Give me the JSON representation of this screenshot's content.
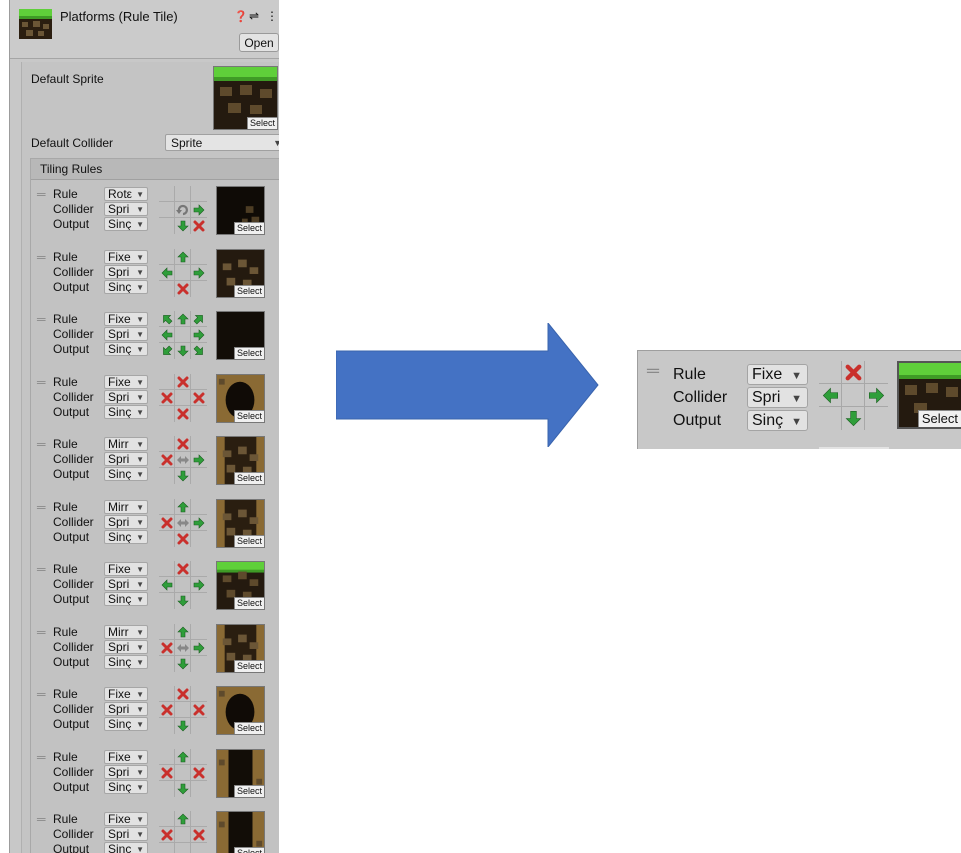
{
  "inspector": {
    "title": "Platforms (Rule Tile)",
    "help_icon": "help-icon",
    "preset_icon": "preset-icon",
    "more_icon": "more-icon",
    "open_label": "Open",
    "default_sprite_label": "Default Sprite",
    "select_label": "Select",
    "default_collider_label": "Default Collider",
    "default_collider_value": "Sprite",
    "tiling_rules_label": "Tiling Rules"
  },
  "labels": {
    "rule": "Rule",
    "collider": "Collider",
    "output": "Output"
  },
  "rules": [
    {
      "rule": "Rotε",
      "collider": "Spri",
      "output": "Sinç",
      "grid": [
        "",
        "",
        "",
        "",
        "rot",
        "right",
        "",
        "down",
        "x"
      ],
      "sprite": "dirt-corner"
    },
    {
      "rule": "Fixe",
      "collider": "Spri",
      "output": "Sinç",
      "grid": [
        "",
        "up",
        "",
        "left",
        "",
        "right",
        "",
        "x",
        ""
      ],
      "sprite": "dirt-full"
    },
    {
      "rule": "Fixe",
      "collider": "Spri",
      "output": "Sinç",
      "grid": [
        "upleft",
        "up",
        "upright",
        "left",
        "",
        "right",
        "downleft",
        "down",
        "downright"
      ],
      "sprite": "dark"
    },
    {
      "rule": "Fixe",
      "collider": "Spri",
      "output": "Sinç",
      "grid": [
        "",
        "x",
        "",
        "x",
        "",
        "x",
        "",
        "x",
        ""
      ],
      "sprite": "hole"
    },
    {
      "rule": "Mirr",
      "collider": "Spri",
      "output": "Sinç",
      "grid": [
        "",
        "x",
        "",
        "x",
        "mirror",
        "right",
        "",
        "down",
        ""
      ],
      "sprite": "dirt-edge"
    },
    {
      "rule": "Mirr",
      "collider": "Spri",
      "output": "Sinç",
      "grid": [
        "",
        "up",
        "",
        "x",
        "mirror",
        "right",
        "",
        "x",
        ""
      ],
      "sprite": "dirt-edge"
    },
    {
      "rule": "Fixe",
      "collider": "Spri",
      "output": "Sinç",
      "grid": [
        "",
        "x",
        "",
        "left",
        "",
        "right",
        "",
        "down",
        ""
      ],
      "sprite": "grass"
    },
    {
      "rule": "Mirr",
      "collider": "Spri",
      "output": "Sinç",
      "grid": [
        "",
        "up",
        "",
        "x",
        "mirror",
        "right",
        "",
        "down",
        ""
      ],
      "sprite": "dirt-edge"
    },
    {
      "rule": "Fixe",
      "collider": "Spri",
      "output": "Sinç",
      "grid": [
        "",
        "x",
        "",
        "x",
        "",
        "x",
        "",
        "down",
        ""
      ],
      "sprite": "hole"
    },
    {
      "rule": "Fixe",
      "collider": "Spri",
      "output": "Sinç",
      "grid": [
        "",
        "up",
        "",
        "x",
        "",
        "x",
        "",
        "down",
        ""
      ],
      "sprite": "column"
    },
    {
      "rule": "Fixe",
      "collider": "Spri",
      "output": "Sinç",
      "grid": [
        "",
        "up",
        "",
        "x",
        "",
        "x",
        "",
        "",
        ""
      ],
      "sprite": "column"
    }
  ],
  "zoomed_rule": {
    "rule": "Fixe",
    "collider": "Spri",
    "output": "Sinç",
    "grid": [
      "",
      "x",
      "",
      "left",
      "",
      "right",
      "",
      "down",
      ""
    ],
    "sprite": "grass"
  },
  "colors": {
    "arrow": "#4472c4",
    "arrow_green": "#2f9e3a",
    "cross_red": "#c9302c",
    "panel": "#c8c8c8"
  },
  "arrow_icon": "right-arrow-icon"
}
